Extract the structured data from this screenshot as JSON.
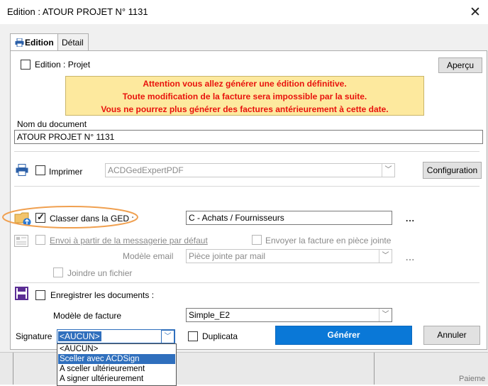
{
  "window": {
    "title": "Edition : ATOUR PROJET N° 1131"
  },
  "background": {
    "text": "Paieme"
  },
  "tabs": [
    {
      "label": "Edition"
    },
    {
      "label": "Détail"
    }
  ],
  "edition_projet": {
    "label": "Edition : Projet",
    "checked": false
  },
  "apercu_button": "Aperçu",
  "warning": {
    "line1": "Attention vous allez générer une édition définitive.",
    "line2": "Toute  modification  de la facture sera impossible par la suite.",
    "line3": "Vous ne pourrez plus générer des factures antérieurement à cette date."
  },
  "document_name": {
    "label": "Nom du document",
    "value": "ATOUR PROJET N° 1131"
  },
  "print": {
    "label": "Imprimer",
    "printer": "ACDGedExpertPDF",
    "config_button": "Configuration",
    "checked": false
  },
  "ged": {
    "label": "Classer dans la GED :",
    "value": "C - Achats / Fournisseurs",
    "dots": "...",
    "checked": true
  },
  "email": {
    "label": "Envoi à partir de la messagerie par défaut",
    "attach_invoice_label": "Envoyer la facture en pièce jointe",
    "model_label": "Modèle email",
    "model_value": "Pièce jointe par mail",
    "dots": "...",
    "join_file_label": "Joindre un fichier"
  },
  "save_docs": {
    "label": "Enregistrer les documents :",
    "checked": false
  },
  "invoice_model": {
    "label": "Modèle de facture",
    "value": "Simple_E2"
  },
  "signature": {
    "label": "Signature",
    "value": "<AUCUN>",
    "options": [
      "<AUCUN>",
      "Sceller avec ACDSign",
      "A sceller ultérieurement",
      "A signer ultérieurement"
    ],
    "highlighted_index": 1
  },
  "duplicata": {
    "label": "Duplicata",
    "checked": false
  },
  "generate_button": "Générer",
  "cancel_button": "Annuler",
  "colors": {
    "generate": "#0a78d7",
    "highlight": "#2f6fbd",
    "warning_bg": "#fde99e",
    "warning_text": "#e8120c",
    "ellipse": "#f0a050"
  }
}
